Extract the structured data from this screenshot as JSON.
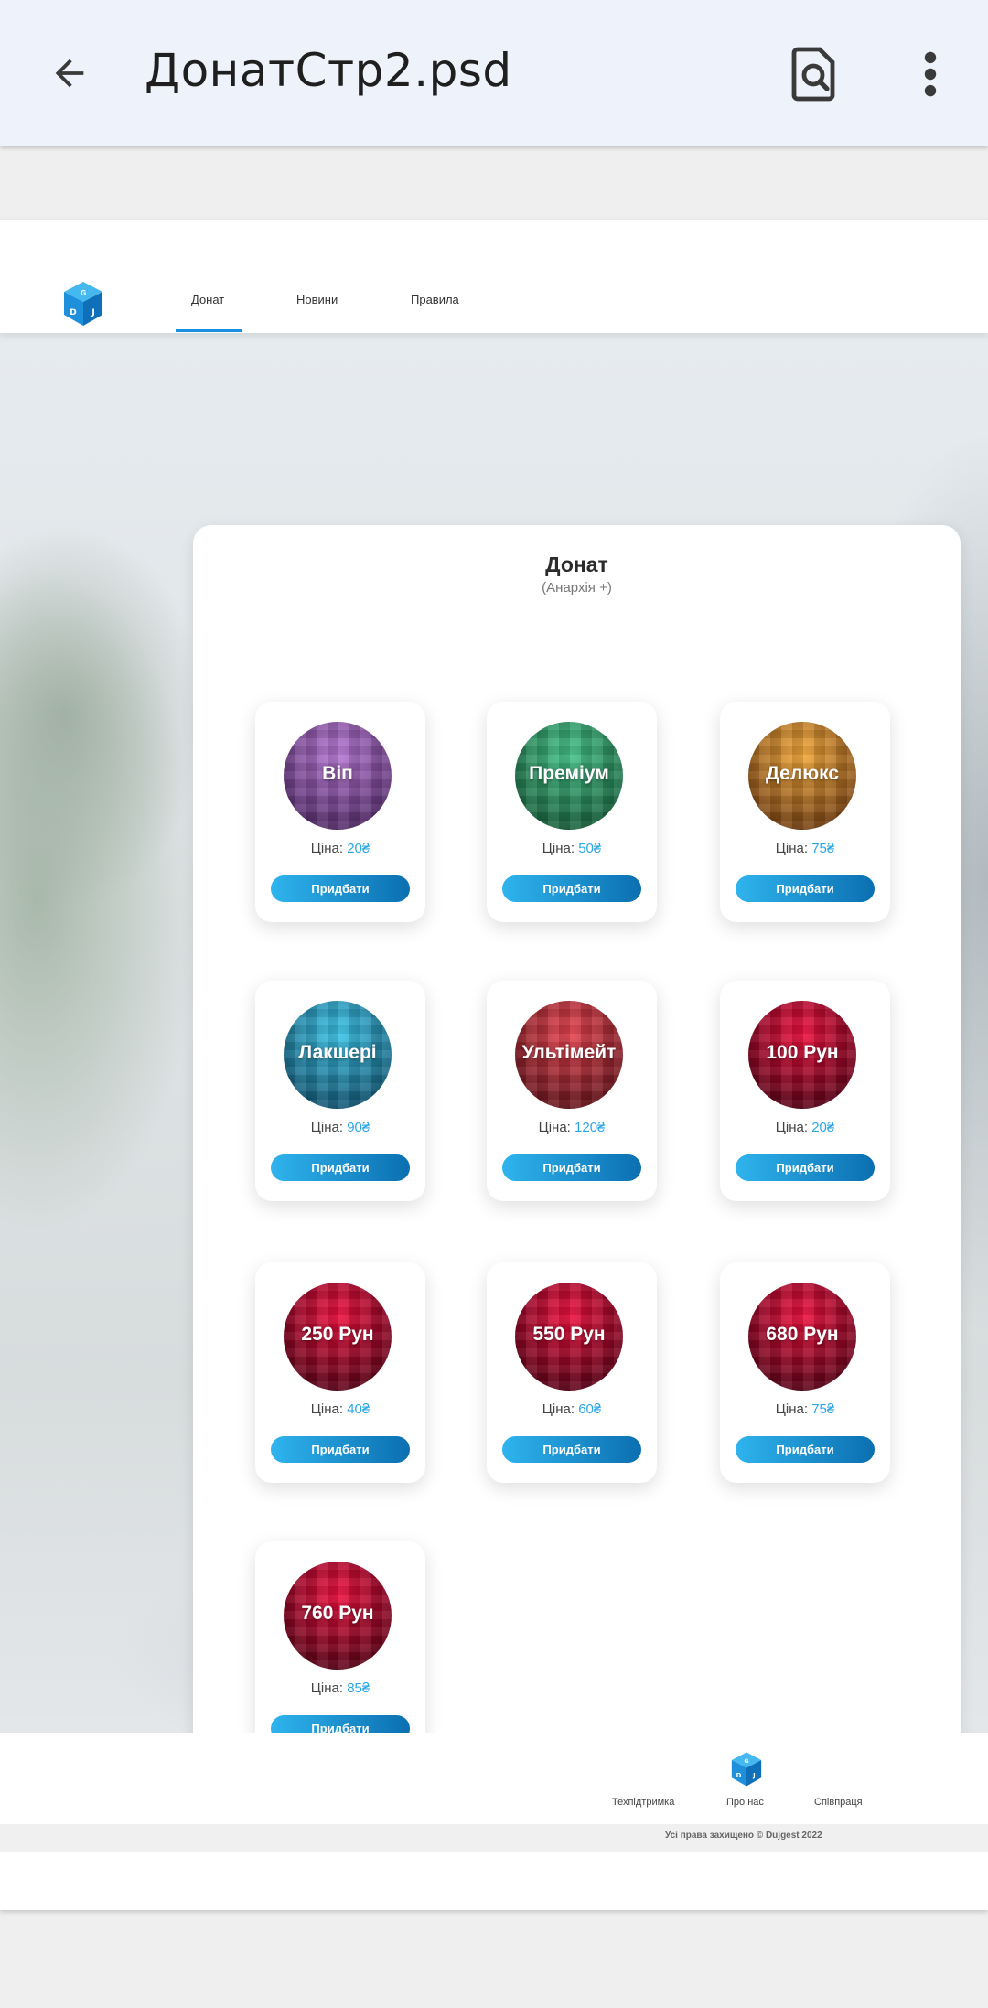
{
  "viewer": {
    "file_name": "ДонатСтр2.psd",
    "icons": {
      "back": "arrow-back-icon",
      "find": "find-in-page-icon",
      "more": "more-vert-icon"
    }
  },
  "site": {
    "nav": [
      {
        "label": "Донат",
        "active": true
      },
      {
        "label": "Новини",
        "active": false
      },
      {
        "label": "Правила",
        "active": false
      }
    ],
    "logo_letters": "DJG",
    "panel": {
      "title": "Донат",
      "subtitle": "(Анархія +)"
    },
    "price_prefix": "Ціна:",
    "buy_label": "Придбати",
    "currency": "₴",
    "products": [
      {
        "name": "Віп",
        "price": "20₴",
        "color_top": "#b878d6",
        "color_bottom": "#3e1c52"
      },
      {
        "name": "Преміум",
        "price": "50₴",
        "color_top": "#45c48a",
        "color_bottom": "#0f4b2c"
      },
      {
        "name": "Делюкс",
        "price": "75₴",
        "color_top": "#f4a93a",
        "color_bottom": "#5a2a0a"
      },
      {
        "name": "Лакшері",
        "price": "90₴",
        "color_top": "#3cc6ea",
        "color_bottom": "#0a3e5a"
      },
      {
        "name": "Ультімейт",
        "price": "120₴",
        "color_top": "#e8434f",
        "color_bottom": "#4a0b12"
      },
      {
        "name": "100 Рун",
        "price": "20₴",
        "color_top": "#f0103e",
        "color_bottom": "#3a0010"
      },
      {
        "name": "250 Рун",
        "price": "40₴",
        "color_top": "#f0103e",
        "color_bottom": "#3a0010"
      },
      {
        "name": "550 Рун",
        "price": "60₴",
        "color_top": "#f0103e",
        "color_bottom": "#3a0010"
      },
      {
        "name": "680 Рун",
        "price": "75₴",
        "color_top": "#f0103e",
        "color_bottom": "#3a0010"
      },
      {
        "name": "760 Рун",
        "price": "85₴",
        "color_top": "#f0103e",
        "color_bottom": "#3a0010"
      }
    ],
    "footer": {
      "links": [
        "Техпідтримка",
        "Про нас",
        "Співпраця"
      ],
      "copyright": "Усі права захищено © Dujgest 2022"
    },
    "accent_color": "#1b8fe0"
  }
}
